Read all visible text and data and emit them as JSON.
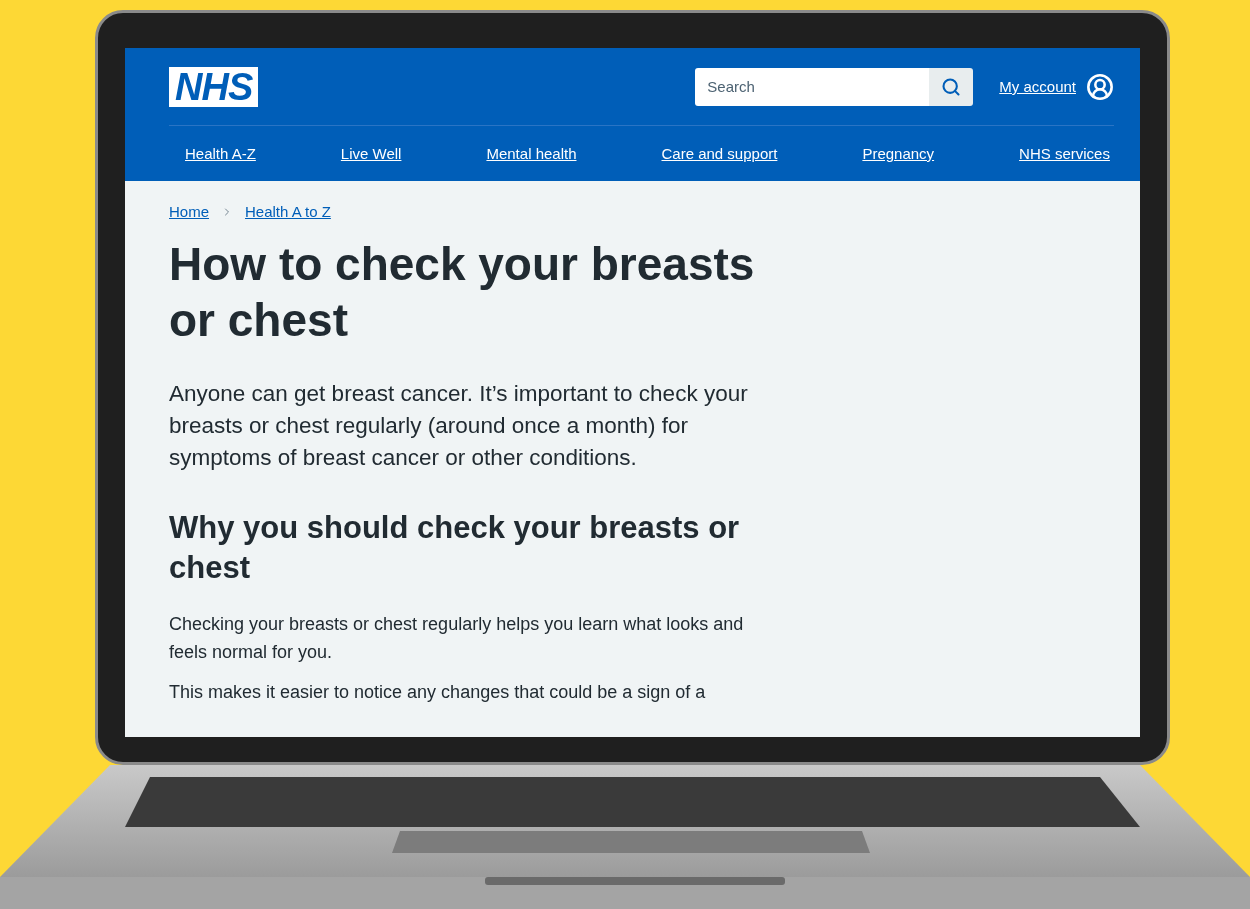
{
  "logo": "NHS",
  "search": {
    "placeholder": "Search"
  },
  "account": {
    "label": "My account"
  },
  "nav": [
    {
      "label": "Health A-Z"
    },
    {
      "label": "Live Well"
    },
    {
      "label": "Mental health"
    },
    {
      "label": "Care and support"
    },
    {
      "label": "Pregnancy"
    },
    {
      "label": "NHS services"
    }
  ],
  "breadcrumbs": [
    {
      "label": "Home"
    },
    {
      "label": "Health A to Z"
    }
  ],
  "title": "How to check your breasts or chest",
  "intro": "Anyone can get breast cancer. It’s important to check your breasts or chest regularly (around once a month) for symptoms of breast cancer or other conditions.",
  "section": {
    "heading": "Why you should check your breasts or chest",
    "paragraphs": [
      "Checking your breasts or chest regularly helps you learn what looks and feels normal for you.",
      "This makes it easier to notice any changes that could be a sign of a"
    ]
  }
}
